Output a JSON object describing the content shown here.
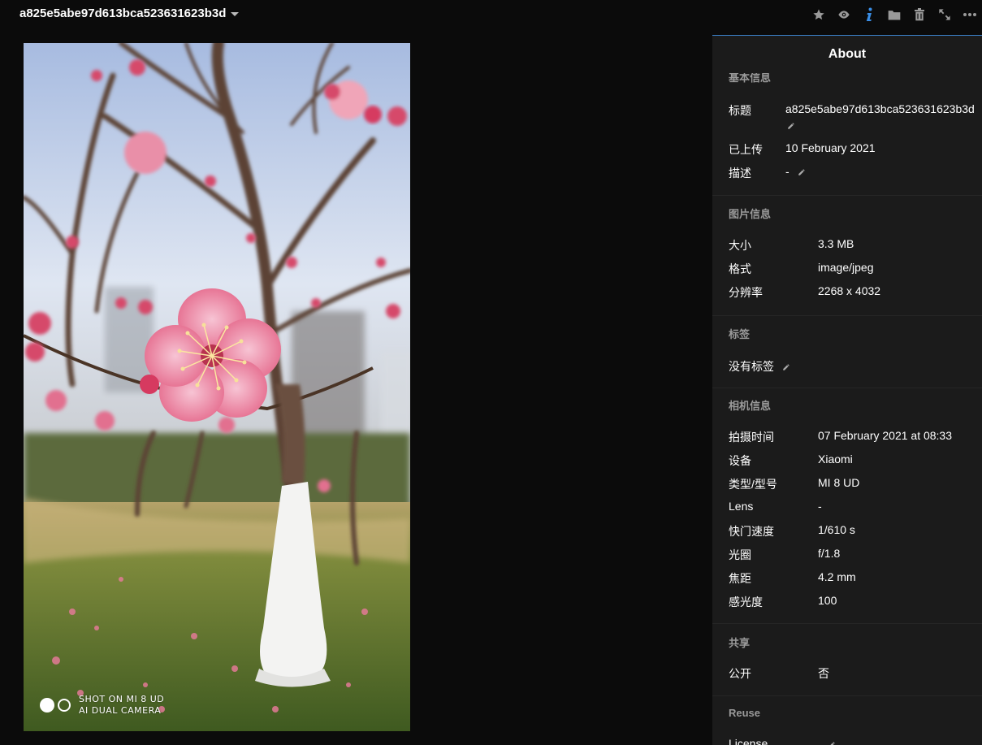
{
  "header": {
    "title": "a825e5abe97d613bca523631623b3d",
    "toolbar": [
      {
        "name": "star-icon"
      },
      {
        "name": "eye-icon"
      },
      {
        "name": "info-icon"
      },
      {
        "name": "folder-icon"
      },
      {
        "name": "trash-icon"
      },
      {
        "name": "fullscreen-icon"
      },
      {
        "name": "more-icon"
      }
    ]
  },
  "photo": {
    "watermark_line1": "SHOT ON MI 8 UD",
    "watermark_line2": "AI DUAL CAMERA"
  },
  "sidebar": {
    "title": "About",
    "basic": {
      "heading": "基本信息",
      "title_label": "标题",
      "title_value": "a825e5abe97d613bca523631623b3d",
      "uploaded_label": "已上传",
      "uploaded_value": "10 February 2021",
      "description_label": "描述",
      "description_value": "-"
    },
    "image_info": {
      "heading": "图片信息",
      "size_label": "大小",
      "size_value": "3.3 MB",
      "format_label": "格式",
      "format_value": "image/jpeg",
      "resolution_label": "分辨率",
      "resolution_value": "2268 x 4032"
    },
    "tags": {
      "heading": "标签",
      "none_label": "没有标签"
    },
    "camera": {
      "heading": "相机信息",
      "taken_label": "拍摄时间",
      "taken_value": "07 February 2021 at 08:33",
      "device_label": "设备",
      "device_value": "Xiaomi",
      "model_label": "类型/型号",
      "model_value": "MI 8 UD",
      "lens_label": "Lens",
      "lens_value": "-",
      "shutter_label": "快门速度",
      "shutter_value": "1/610 s",
      "aperture_label": "光圈",
      "aperture_value": "f/1.8",
      "focal_label": "焦距",
      "focal_value": "4.2 mm",
      "iso_label": "感光度",
      "iso_value": "100"
    },
    "share": {
      "heading": "共享",
      "public_label": "公开",
      "public_value": "否"
    },
    "reuse": {
      "heading": "Reuse",
      "license_label": "License"
    }
  },
  "colors": {
    "background": "#0b0b0b",
    "sidebar": "#1b1b1b",
    "accent": "#3a7ec6",
    "muted": "#9a9a9a"
  }
}
